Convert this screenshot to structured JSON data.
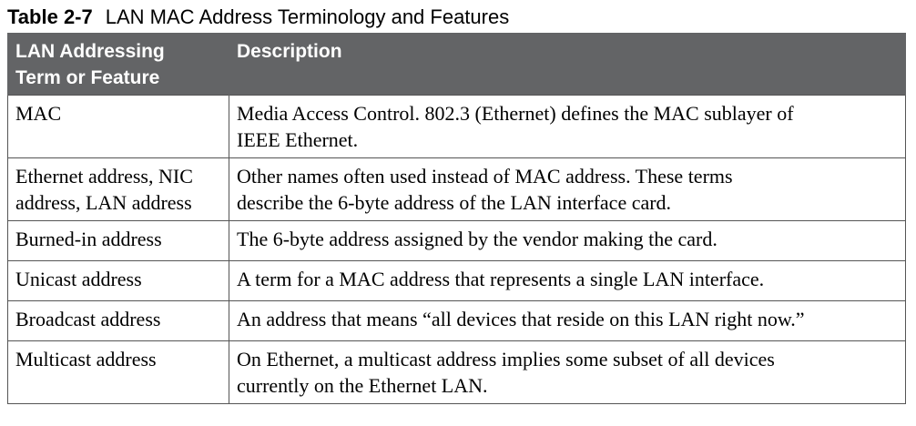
{
  "caption": {
    "number": "Table 2-7",
    "title": "LAN MAC Address Terminology and Features"
  },
  "table": {
    "headers": {
      "term_line1": "LAN Addressing",
      "term_line2": "Term or Feature",
      "description": "Description"
    },
    "rows": [
      {
        "term_lines": [
          "MAC"
        ],
        "desc_lines": [
          "Media Access Control. 802.3 (Ethernet) defines the MAC sublayer of",
          "IEEE Ethernet."
        ]
      },
      {
        "term_lines": [
          "Ethernet address, NIC",
          "address, LAN address"
        ],
        "desc_lines": [
          "Other names often used instead of MAC address. These terms",
          "describe the 6-byte address of the LAN interface card."
        ]
      },
      {
        "term_lines": [
          "Burned-in address"
        ],
        "desc_lines": [
          "The 6-byte address assigned by the vendor making the card."
        ]
      },
      {
        "term_lines": [
          "Unicast address"
        ],
        "desc_lines": [
          "A term for a MAC address that represents a single LAN interface."
        ]
      },
      {
        "term_lines": [
          "Broadcast address"
        ],
        "desc_lines": [
          "An address that means “all devices that reside on this LAN right now.”"
        ]
      },
      {
        "term_lines": [
          "Multicast address"
        ],
        "desc_lines": [
          "On Ethernet, a multicast address implies some subset of all devices",
          "currently on the Ethernet LAN."
        ]
      }
    ]
  }
}
